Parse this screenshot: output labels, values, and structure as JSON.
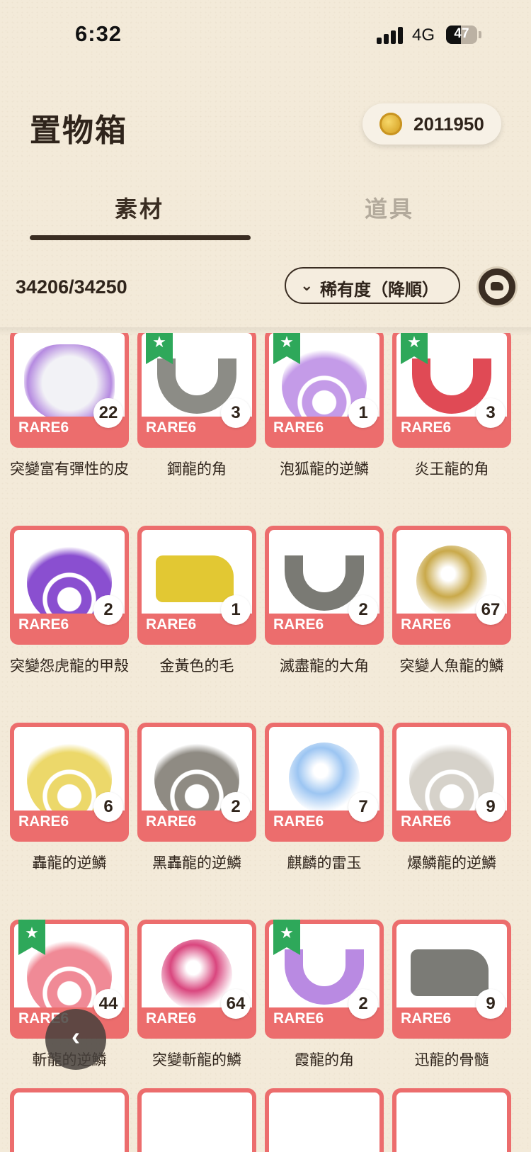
{
  "status": {
    "time": "6:32",
    "network": "4G",
    "battery": "47",
    "battery_level": 0.47
  },
  "header": {
    "title": "置物箱",
    "coins": "2011950"
  },
  "tabs": [
    {
      "label": "素材",
      "active": true
    },
    {
      "label": "道具",
      "active": false
    }
  ],
  "toolbar": {
    "count": "34206/34250",
    "sort_label": "稀有度（降順）",
    "sort_icon": "chevron-down-icon",
    "filter_icon": "monster-filter-icon"
  },
  "colors": {
    "card_border": "#ec6d6d",
    "ribbon": "#2ea85a",
    "text_dark": "#2f241b"
  },
  "items": [
    {
      "name": "突變富有彈性的皮",
      "rarity": "RARE6",
      "qty": "22",
      "starred": false,
      "art": "blob",
      "color": "#b58ae0"
    },
    {
      "name": "鋼龍的角",
      "rarity": "RARE6",
      "qty": "3",
      "starred": true,
      "art": "horn",
      "color": "#8c8c86"
    },
    {
      "name": "泡狐龍的逆鱗",
      "rarity": "RARE6",
      "qty": "1",
      "starred": true,
      "art": "scale",
      "color": "#c49be8"
    },
    {
      "name": "炎王龍的角",
      "rarity": "RARE6",
      "qty": "3",
      "starred": true,
      "art": "horn",
      "color": "#e04a55"
    },
    {
      "name": "突變怨虎龍的甲殼",
      "rarity": "RARE6",
      "qty": "2",
      "starred": false,
      "art": "scale",
      "color": "#8a4fd0"
    },
    {
      "name": "金黃色的毛",
      "rarity": "RARE6",
      "qty": "1",
      "starred": false,
      "art": "head",
      "color": "#e2c833"
    },
    {
      "name": "滅盡龍的大角",
      "rarity": "RARE6",
      "qty": "2",
      "starred": false,
      "art": "horn",
      "color": "#7a7a74"
    },
    {
      "name": "突變人魚龍的鱗",
      "rarity": "RARE6",
      "qty": "67",
      "starred": false,
      "art": "orb",
      "color": "#c9a94a"
    },
    {
      "name": "轟龍的逆鱗",
      "rarity": "RARE6",
      "qty": "6",
      "starred": false,
      "art": "scale",
      "color": "#ecd86a"
    },
    {
      "name": "黑轟龍的逆鱗",
      "rarity": "RARE6",
      "qty": "2",
      "starred": false,
      "art": "scale",
      "color": "#8f8b83"
    },
    {
      "name": "麒麟的雷玉",
      "rarity": "RARE6",
      "qty": "7",
      "starred": false,
      "art": "orb",
      "color": "#9cc5f2"
    },
    {
      "name": "爆鱗龍的逆鱗",
      "rarity": "RARE6",
      "qty": "9",
      "starred": false,
      "art": "scale",
      "color": "#d6d2ca"
    },
    {
      "name": "斬龍的逆鱗",
      "rarity": "RARE6",
      "qty": "44",
      "starred": true,
      "art": "scale",
      "color": "#f08a96"
    },
    {
      "name": "突變斬龍的鱗",
      "rarity": "RARE6",
      "qty": "64",
      "starred": false,
      "art": "orb",
      "color": "#d9467e"
    },
    {
      "name": "霞龍的角",
      "rarity": "RARE6",
      "qty": "2",
      "starred": true,
      "art": "horn",
      "color": "#b98ae2"
    },
    {
      "name": "迅龍的骨髓",
      "rarity": "RARE6",
      "qty": "9",
      "starred": false,
      "art": "head",
      "color": "#7b7b76"
    }
  ],
  "back_button_icon": "chevron-left-icon"
}
